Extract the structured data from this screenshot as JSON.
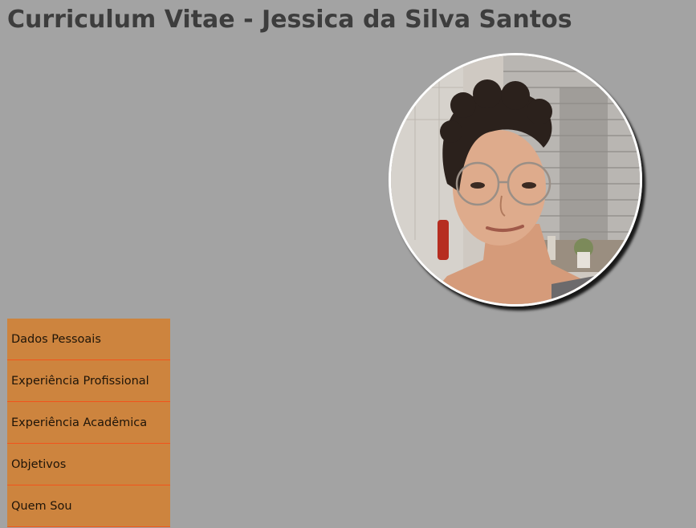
{
  "header": {
    "title": "Curriculum Vitae - Jessica da Silva Santos"
  },
  "profile": {
    "photo_icon": "portrait-photo"
  },
  "nav": {
    "items": [
      {
        "label": "Dados Pessoais"
      },
      {
        "label": "Experiência Profissional"
      },
      {
        "label": "Experiência Acadêmica"
      },
      {
        "label": "Objetivos"
      },
      {
        "label": "Quem Sou"
      }
    ]
  },
  "colors": {
    "background": "#a3a3a3",
    "title": "#3d3d3d",
    "nav_background": "#cd843e",
    "nav_divider": "#f2541c"
  }
}
